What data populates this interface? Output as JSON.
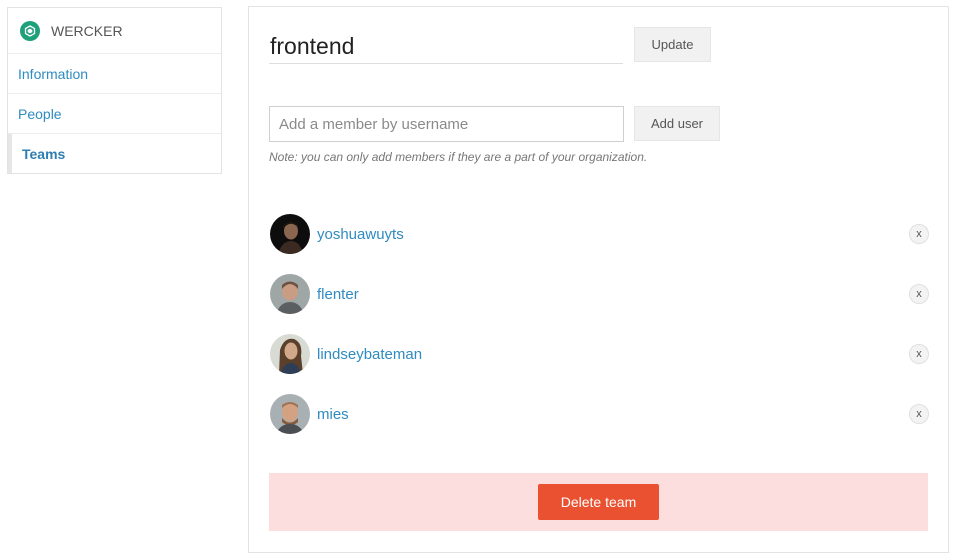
{
  "sidebar": {
    "org_name": "WERCKER",
    "items": [
      {
        "label": "Information"
      },
      {
        "label": "People"
      },
      {
        "label": "Teams"
      }
    ]
  },
  "team": {
    "name": "frontend",
    "update_label": "Update"
  },
  "add_member": {
    "placeholder": "Add a member by username",
    "value": "",
    "button_label": "Add user",
    "note": "Note: you can only add members if they are a part of your organization."
  },
  "members": [
    {
      "username": "yoshuawuyts",
      "remove_label": "x"
    },
    {
      "username": "flenter",
      "remove_label": "x"
    },
    {
      "username": "lindseybateman",
      "remove_label": "x"
    },
    {
      "username": "mies",
      "remove_label": "x"
    }
  ],
  "danger": {
    "delete_label": "Delete team"
  },
  "colors": {
    "link": "#2f8bc1",
    "brand": "#1ea07a",
    "danger_bg": "#fbdedd",
    "danger_button": "#ea5131"
  }
}
